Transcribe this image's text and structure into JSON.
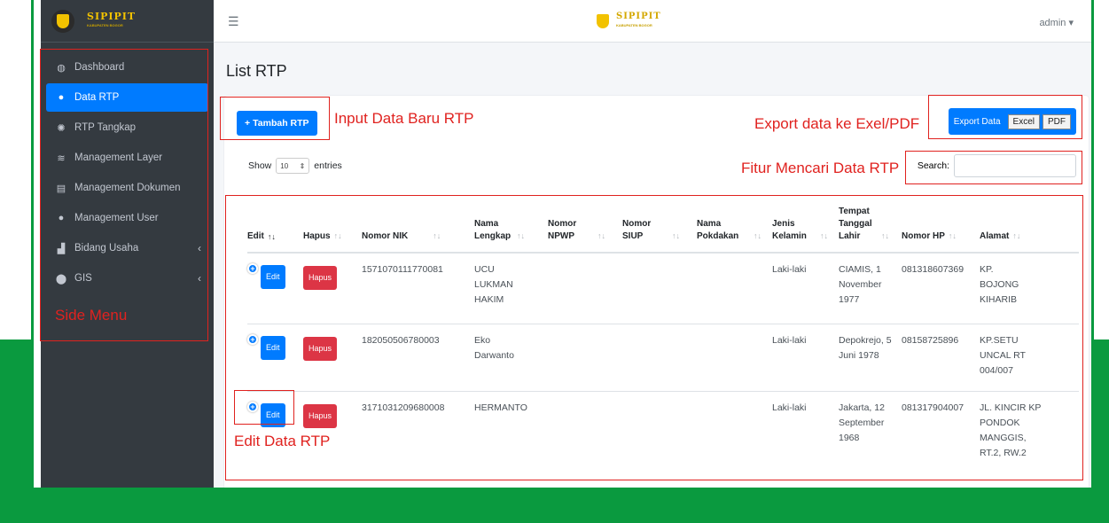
{
  "brand": {
    "name": "SIPIPIT",
    "sub": "KABUPATEN BOGOR"
  },
  "topbar": {
    "menu_icon": "hamburger-icon",
    "user": "admin"
  },
  "sidebar": {
    "items": [
      {
        "label": "Dashboard",
        "icon": "dashboard-icon"
      },
      {
        "label": "Data RTP",
        "icon": "user-icon",
        "active": true
      },
      {
        "label": "RTP Tangkap",
        "icon": "gear-icon"
      },
      {
        "label": "Management Layer",
        "icon": "layers-icon"
      },
      {
        "label": "Management Dokumen",
        "icon": "document-icon"
      },
      {
        "label": "Management User",
        "icon": "user-icon"
      },
      {
        "label": "Bidang Usaha",
        "icon": "chart-icon"
      },
      {
        "label": "GIS",
        "icon": "map-marker-icon"
      }
    ]
  },
  "page": {
    "title": "List RTP"
  },
  "toolbar": {
    "add_label": "Tambah RTP",
    "export_label": "Export Data",
    "excel": "Excel",
    "pdf": "PDF"
  },
  "table_controls": {
    "show": "Show",
    "entries_value": "10",
    "entries": "entries",
    "search_label": "Search:"
  },
  "table": {
    "headers": [
      "Edit",
      "Hapus",
      "Nomor NIK",
      "Nama Lengkap",
      "Nomor NPWP",
      "Nomor SIUP",
      "Nama Pokdakan",
      "Jenis Kelamin",
      "Tempat Tanggal Lahir",
      "Nomor HP",
      "Alamat"
    ],
    "edit_label": "Edit",
    "hapus_label": "Hapus",
    "rows": [
      {
        "nik": "1571070111770081",
        "nama": "UCU LUKMAN HAKIM",
        "npwp": "",
        "siup": "",
        "pokdakan": "",
        "jk": "Laki-laki",
        "ttl": "CIAMIS, 1 November 1977",
        "hp": "081318607369",
        "alamat": "KP. BOJONG KIHARIB"
      },
      {
        "nik": "182050506780003",
        "nama": "Eko Darwanto",
        "npwp": "",
        "siup": "",
        "pokdakan": "",
        "jk": "Laki-laki",
        "ttl": "Depokrejo, 5 Juni 1978",
        "hp": "08158725896",
        "alamat": "KP.SETU UNCAL RT 004/007"
      },
      {
        "nik": "3171031209680008",
        "nama": "HERMANTO",
        "npwp": "",
        "siup": "",
        "pokdakan": "",
        "jk": "Laki-laki",
        "ttl": "Jakarta, 12 September 1968",
        "hp": "081317904007",
        "alamat": "JL. KINCIR KP PONDOK MANGGIS, RT.2, RW.2"
      }
    ]
  },
  "annotations": {
    "side_menu": "Side Menu",
    "input_baru": "Input Data Baru RTP",
    "export": "Export data ke Exel/PDF",
    "search": "Fitur Mencari Data RTP",
    "edit": "Edit Data  RTP"
  },
  "colors": {
    "sidebar_bg": "#343a40",
    "primary": "#007bff",
    "danger": "#dc3545",
    "annotation": "#e0221f",
    "green_band": "#0a9a3f"
  }
}
